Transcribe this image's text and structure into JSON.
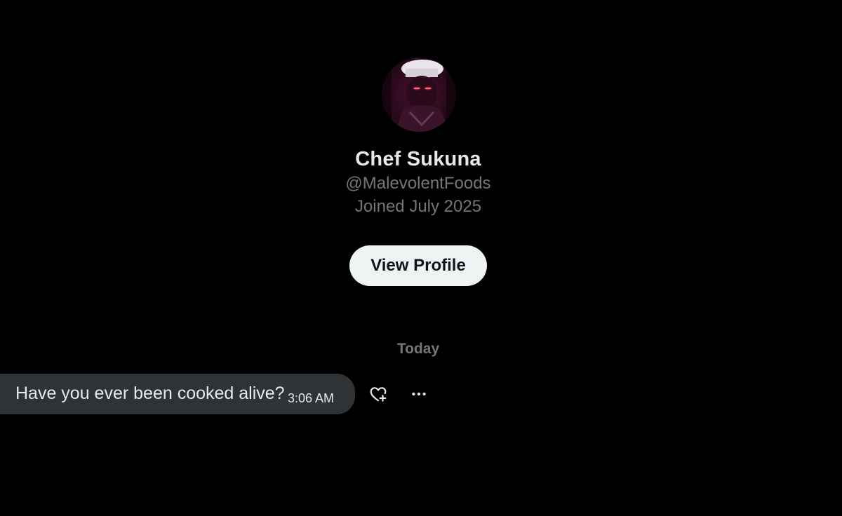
{
  "profile": {
    "display_name": "Chef Sukuna",
    "handle": "@MalevolentFoods",
    "joined": "Joined July 2025",
    "view_profile_label": "View Profile",
    "avatar_icon": "avatar-chef-portrait"
  },
  "conversation": {
    "day_divider": "Today",
    "messages": [
      {
        "text": "Have you ever been cooked alive?",
        "time": "3:06 AM"
      }
    ]
  },
  "icons": {
    "react": "heart-plus-icon",
    "more": "more-horizontal-icon"
  },
  "colors": {
    "background": "#000000",
    "primary_text": "#e7e9ea",
    "secondary_text": "#71767b",
    "bubble": "#2f3336",
    "button_bg": "#eff3f4",
    "button_text": "#0f1419"
  }
}
